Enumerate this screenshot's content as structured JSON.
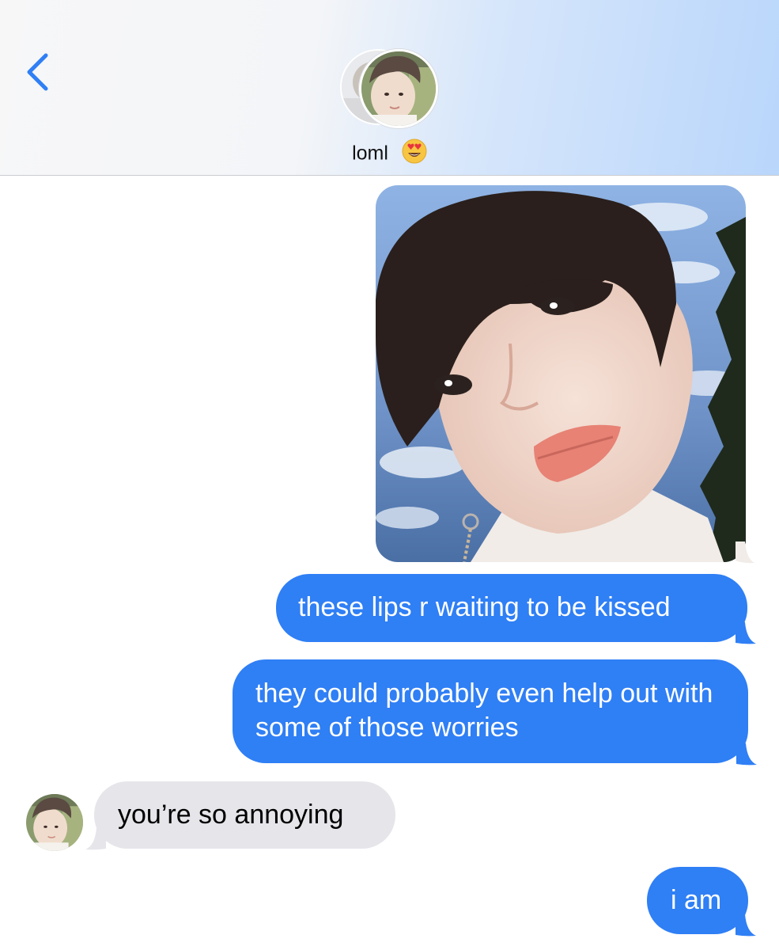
{
  "header": {
    "contact_name": "loml",
    "name_emoji_icon": "heart-eyes-emoji-icon",
    "back_icon": "chevron-left-icon",
    "accent_color": "#2f7ff5"
  },
  "messages": [
    {
      "direction": "sent",
      "type": "image",
      "image_icon": "selfie-photo"
    },
    {
      "direction": "sent",
      "type": "text",
      "text": "these lips r waiting to be kissed"
    },
    {
      "direction": "sent",
      "type": "text",
      "text": "they could probably even help out with some of those worries"
    },
    {
      "direction": "received",
      "type": "text",
      "text": "you’re so annoying"
    },
    {
      "direction": "sent",
      "type": "text",
      "text": "i am"
    }
  ],
  "colors": {
    "sent_bubble": "#2f7ff5",
    "received_bubble": "#e6e5ea"
  }
}
